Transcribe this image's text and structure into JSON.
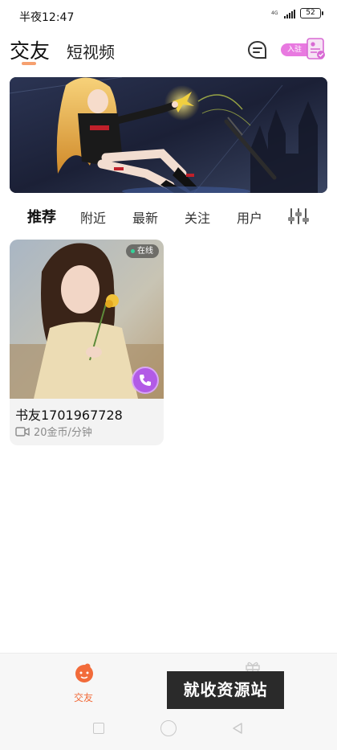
{
  "status_bar": {
    "time": "半夜12:47",
    "network": "4G",
    "battery": "52"
  },
  "header": {
    "tab_active": "交友",
    "tab_secondary": "短视频",
    "join_label": "入驻"
  },
  "banner": {
    "colors": {
      "sky": "#1b2036",
      "accent": "#f0d040",
      "red": "#c0202a"
    }
  },
  "filters": {
    "tabs": [
      "推荐",
      "附近",
      "最新",
      "关注",
      "用户"
    ],
    "active_index": 0
  },
  "card": {
    "status": "在线",
    "name": "书友1701967728",
    "price": "20金币/分钟",
    "icons": {
      "call": "phone-icon",
      "video": "video-icon"
    }
  },
  "bottom_nav": {
    "items": [
      {
        "label": "交友",
        "icon": "friends-icon",
        "active": true
      },
      {
        "label": "",
        "icon": "gift-icon",
        "active": false
      }
    ],
    "watermark": "就收资源站",
    "accent": "#f26b3a"
  }
}
